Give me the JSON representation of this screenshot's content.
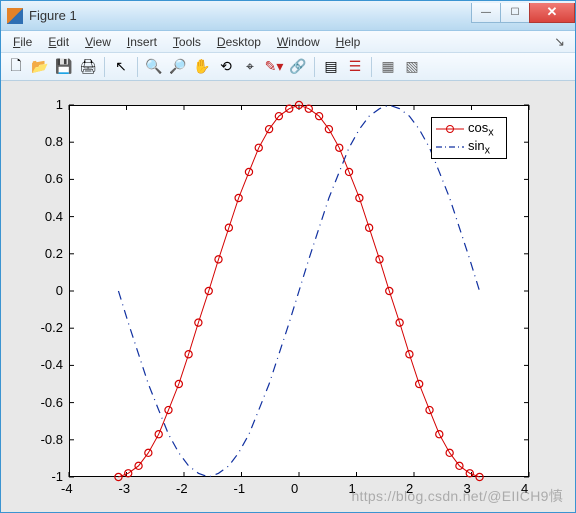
{
  "window": {
    "title": "Figure 1"
  },
  "menubar": {
    "items": [
      "File",
      "Edit",
      "View",
      "Insert",
      "Tools",
      "Desktop",
      "Window",
      "Help"
    ]
  },
  "toolbar": {
    "names": [
      "new-figure",
      "open",
      "save",
      "print",
      "arrow",
      "zoom-in",
      "zoom-out",
      "pan",
      "rotate-3d",
      "data-cursor",
      "brush",
      "link",
      "insert-colorbar",
      "insert-legend",
      "hide-plot-tools",
      "show-plot-tools"
    ]
  },
  "chart_data": {
    "type": "line",
    "xlim": [
      -4,
      4
    ],
    "ylim": [
      -1,
      1
    ],
    "xticks": [
      -4,
      -3,
      -2,
      -1,
      0,
      1,
      2,
      3,
      4
    ],
    "yticks": [
      -1,
      -0.8,
      -0.6,
      -0.4,
      -0.2,
      0,
      0.2,
      0.4,
      0.6,
      0.8,
      1
    ],
    "series": [
      {
        "name": "cos_x",
        "legend_label": "cos",
        "legend_sub": "x",
        "color": "#d40000",
        "style": "line-circle",
        "x": [
          -3.14,
          -2.97,
          -2.79,
          -2.62,
          -2.44,
          -2.27,
          -2.09,
          -1.92,
          -1.75,
          -1.57,
          -1.4,
          -1.22,
          -1.05,
          -0.87,
          -0.7,
          -0.52,
          -0.35,
          -0.17,
          0.0,
          0.17,
          0.35,
          0.52,
          0.7,
          0.87,
          1.05,
          1.22,
          1.4,
          1.57,
          1.75,
          1.92,
          2.09,
          2.27,
          2.44,
          2.62,
          2.79,
          2.97,
          3.14
        ],
        "y": [
          -1.0,
          -0.98,
          -0.94,
          -0.87,
          -0.77,
          -0.64,
          -0.5,
          -0.34,
          -0.17,
          0.0,
          0.17,
          0.34,
          0.5,
          0.64,
          0.77,
          0.87,
          0.94,
          0.98,
          1.0,
          0.98,
          0.94,
          0.87,
          0.77,
          0.64,
          0.5,
          0.34,
          0.17,
          0.0,
          -0.17,
          -0.34,
          -0.5,
          -0.64,
          -0.77,
          -0.87,
          -0.94,
          -0.98,
          -1.0
        ]
      },
      {
        "name": "sin_x",
        "legend_label": "sin",
        "legend_sub": "x",
        "color": "#1030a0",
        "style": "dash-dot",
        "x": [
          -3.14,
          -2.97,
          -2.79,
          -2.62,
          -2.44,
          -2.27,
          -2.09,
          -1.92,
          -1.75,
          -1.57,
          -1.4,
          -1.22,
          -1.05,
          -0.87,
          -0.7,
          -0.52,
          -0.35,
          -0.17,
          0.0,
          0.17,
          0.35,
          0.52,
          0.7,
          0.87,
          1.05,
          1.22,
          1.4,
          1.57,
          1.75,
          1.92,
          2.09,
          2.27,
          2.44,
          2.62,
          2.79,
          2.97,
          3.14
        ],
        "y": [
          0.0,
          -0.17,
          -0.34,
          -0.5,
          -0.64,
          -0.77,
          -0.87,
          -0.94,
          -0.98,
          -1.0,
          -0.98,
          -0.94,
          -0.87,
          -0.77,
          -0.64,
          -0.5,
          -0.34,
          -0.17,
          0.0,
          0.17,
          0.34,
          0.5,
          0.64,
          0.77,
          0.87,
          0.94,
          0.98,
          1.0,
          0.98,
          0.94,
          0.87,
          0.77,
          0.64,
          0.5,
          0.34,
          0.17,
          0.0
        ]
      }
    ]
  },
  "watermark": "https://blog.csdn.net/@EIICH9慎"
}
